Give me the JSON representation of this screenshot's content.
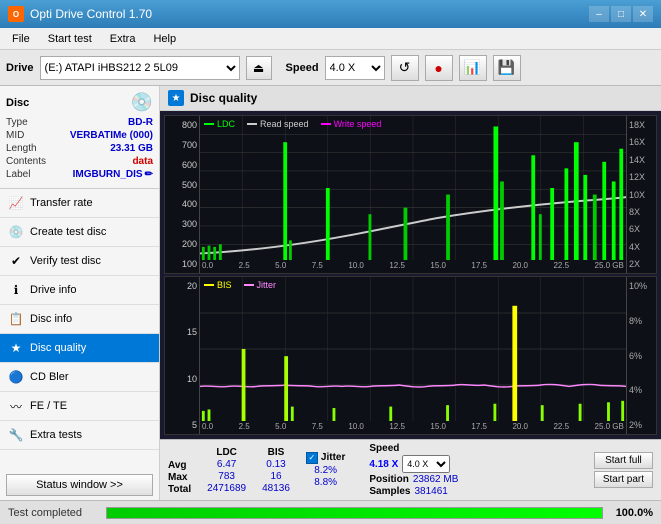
{
  "titlebar": {
    "title": "Opti Drive Control 1.70",
    "icon": "O",
    "minimize": "–",
    "maximize": "□",
    "close": "✕"
  },
  "menubar": {
    "items": [
      "File",
      "Start test",
      "Extra",
      "Help"
    ]
  },
  "toolbar": {
    "drive_label": "Drive",
    "drive_value": "(E:)  ATAPI iHBS212  2 5L09",
    "speed_label": "Speed",
    "speed_value": "4.0 X"
  },
  "disc": {
    "header": "Disc",
    "type_label": "Type",
    "type_val": "BD-R",
    "mid_label": "MID",
    "mid_val": "VERBATIMe (000)",
    "length_label": "Length",
    "length_val": "23.31 GB",
    "contents_label": "Contents",
    "contents_val": "data",
    "label_label": "Label",
    "label_val": "IMGBURN_DIS"
  },
  "nav": {
    "items": [
      {
        "id": "transfer-rate",
        "label": "Transfer rate",
        "icon": "📈"
      },
      {
        "id": "create-test-disc",
        "label": "Create test disc",
        "icon": "💿"
      },
      {
        "id": "verify-test-disc",
        "label": "Verify test disc",
        "icon": "✔"
      },
      {
        "id": "drive-info",
        "label": "Drive info",
        "icon": "ℹ"
      },
      {
        "id": "disc-info",
        "label": "Disc info",
        "icon": "📋"
      },
      {
        "id": "disc-quality",
        "label": "Disc quality",
        "icon": "★",
        "active": true
      },
      {
        "id": "cd-bler",
        "label": "CD Bler",
        "icon": "🔵"
      },
      {
        "id": "fe-te",
        "label": "FE / TE",
        "icon": "〰"
      },
      {
        "id": "extra-tests",
        "label": "Extra tests",
        "icon": "🔧"
      }
    ],
    "status_btn": "Status window >>"
  },
  "dq": {
    "title": "Disc quality",
    "icon": "★"
  },
  "chart1": {
    "legend": [
      {
        "label": "LDC",
        "color": "#00ff00"
      },
      {
        "label": "Read speed",
        "color": "#cccccc"
      },
      {
        "label": "Write speed",
        "color": "#ff00ff"
      }
    ],
    "y_left": [
      "800",
      "700",
      "600",
      "500",
      "400",
      "300",
      "200",
      "100"
    ],
    "y_right": [
      "18X",
      "16X",
      "14X",
      "12X",
      "10X",
      "8X",
      "6X",
      "4X",
      "2X"
    ],
    "x_labels": [
      "0.0",
      "2.5",
      "5.0",
      "7.5",
      "10.0",
      "12.5",
      "15.0",
      "17.5",
      "20.0",
      "22.5",
      "25.0 GB"
    ]
  },
  "chart2": {
    "legend": [
      {
        "label": "BIS",
        "color": "#ffff00"
      },
      {
        "label": "Jitter",
        "color": "#ff00ff"
      }
    ],
    "y_left": [
      "20",
      "15",
      "10",
      "5"
    ],
    "y_right": [
      "10%",
      "8%",
      "6%",
      "4%",
      "2%"
    ],
    "x_labels": [
      "0.0",
      "2.5",
      "5.0",
      "7.5",
      "10.0",
      "12.5",
      "15.0",
      "17.5",
      "20.0",
      "22.5",
      "25.0 GB"
    ]
  },
  "stats": {
    "ldc_label": "LDC",
    "bis_label": "BIS",
    "jitter_label": "Jitter",
    "speed_label": "Speed",
    "position_label": "Position",
    "samples_label": "Samples",
    "avg_label": "Avg",
    "max_label": "Max",
    "total_label": "Total",
    "ldc_avg": "6.47",
    "ldc_max": "783",
    "ldc_total": "2471689",
    "bis_avg": "0.13",
    "bis_max": "16",
    "bis_total": "48136",
    "jitter_avg": "8.2%",
    "jitter_max": "8.8%",
    "jitter_total": "",
    "speed_val": "4.18 X",
    "speed_select": "4.0 X",
    "position_val": "23862 MB",
    "samples_val": "381461",
    "start_full": "Start full",
    "start_part": "Start part"
  },
  "progress": {
    "percent": "100.0%",
    "status": "Test completed"
  }
}
